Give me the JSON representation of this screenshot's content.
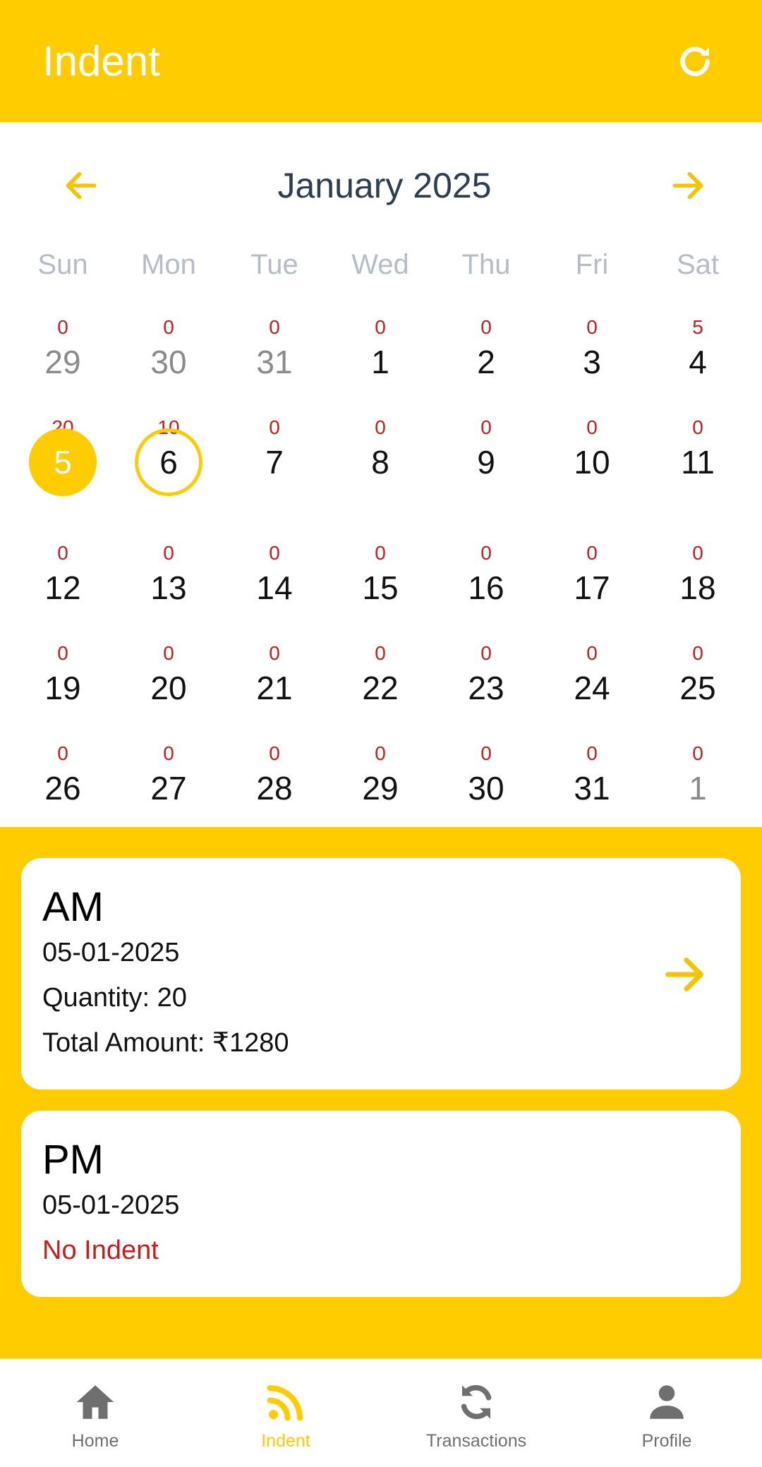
{
  "header": {
    "title": "Indent",
    "refresh_icon": "refresh-icon"
  },
  "colors": {
    "accent": "#FFCC00",
    "count_red": "#CC1B1B",
    "muted": "#B4BCC6"
  },
  "calendar": {
    "month_label": "January 2025",
    "prev_icon": "arrow-left-icon",
    "next_icon": "arrow-right-icon",
    "weekdays": [
      "Sun",
      "Mon",
      "Tue",
      "Wed",
      "Thu",
      "Fri",
      "Sat"
    ],
    "weeks": [
      [
        {
          "num": "29",
          "count": "0",
          "other": true
        },
        {
          "num": "30",
          "count": "0",
          "other": true
        },
        {
          "num": "31",
          "count": "0",
          "other": true
        },
        {
          "num": "1",
          "count": "0"
        },
        {
          "num": "2",
          "count": "0"
        },
        {
          "num": "3",
          "count": "0"
        },
        {
          "num": "4",
          "count": "5"
        }
      ],
      [
        {
          "num": "5",
          "count": "20",
          "selected": true
        },
        {
          "num": "6",
          "count": "10",
          "today": true
        },
        {
          "num": "7",
          "count": "0"
        },
        {
          "num": "8",
          "count": "0"
        },
        {
          "num": "9",
          "count": "0"
        },
        {
          "num": "10",
          "count": "0"
        },
        {
          "num": "11",
          "count": "0"
        }
      ],
      [
        {
          "num": "12",
          "count": "0"
        },
        {
          "num": "13",
          "count": "0"
        },
        {
          "num": "14",
          "count": "0"
        },
        {
          "num": "15",
          "count": "0"
        },
        {
          "num": "16",
          "count": "0"
        },
        {
          "num": "17",
          "count": "0"
        },
        {
          "num": "18",
          "count": "0"
        }
      ],
      [
        {
          "num": "19",
          "count": "0"
        },
        {
          "num": "20",
          "count": "0"
        },
        {
          "num": "21",
          "count": "0"
        },
        {
          "num": "22",
          "count": "0"
        },
        {
          "num": "23",
          "count": "0"
        },
        {
          "num": "24",
          "count": "0"
        },
        {
          "num": "25",
          "count": "0"
        }
      ],
      [
        {
          "num": "26",
          "count": "0"
        },
        {
          "num": "27",
          "count": "0"
        },
        {
          "num": "28",
          "count": "0"
        },
        {
          "num": "29",
          "count": "0"
        },
        {
          "num": "30",
          "count": "0"
        },
        {
          "num": "31",
          "count": "0"
        },
        {
          "num": "1",
          "count": "0",
          "other": true
        }
      ]
    ]
  },
  "am_card": {
    "title": "AM",
    "date": "05-01-2025",
    "quantity": "Quantity: 20",
    "total": "Total Amount: ₹1280",
    "arrow_icon": "arrow-right-icon"
  },
  "pm_card": {
    "title": "PM",
    "date": "05-01-2025",
    "status": "No Indent"
  },
  "bottom_nav": {
    "items": [
      {
        "label": "Home",
        "icon": "home-icon",
        "active": false
      },
      {
        "label": "Indent",
        "icon": "rss-icon",
        "active": true
      },
      {
        "label": "Transactions",
        "icon": "sync-icon",
        "active": false
      },
      {
        "label": "Profile",
        "icon": "person-icon",
        "active": false
      }
    ]
  }
}
